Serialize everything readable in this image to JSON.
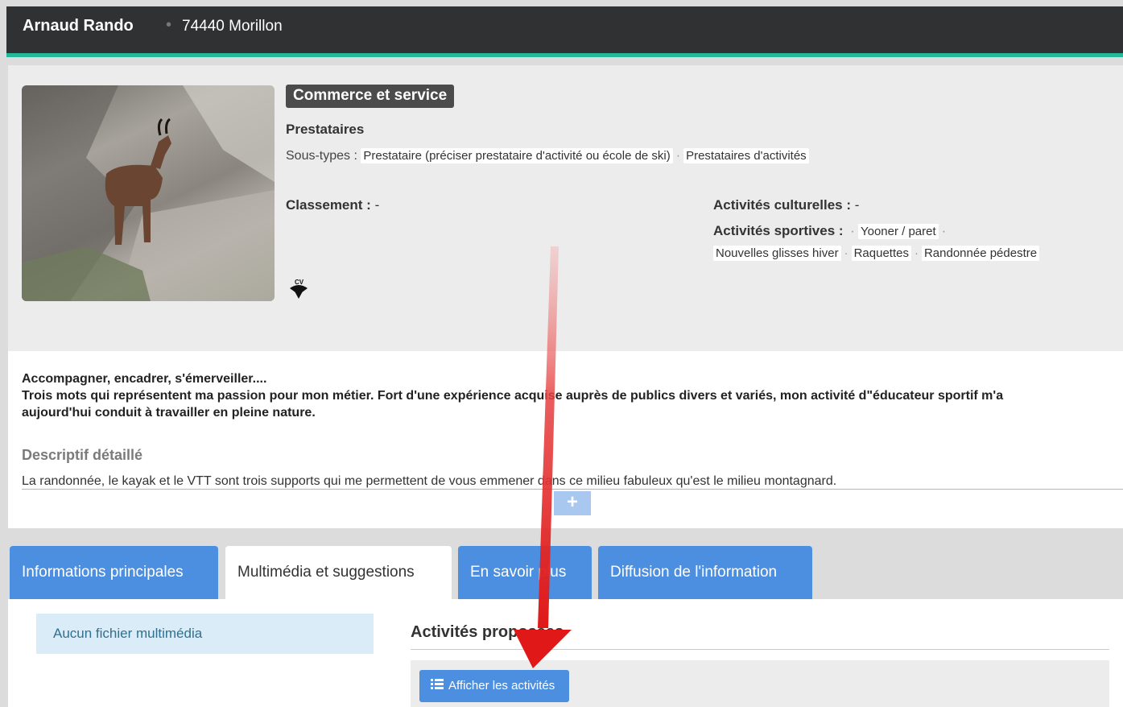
{
  "header": {
    "name": "Arnaud Rando",
    "separator": "•",
    "location": "74440 Morillon"
  },
  "summary": {
    "type_badge": "Commerce et service",
    "category": "Prestataires",
    "subtypes_label": "Sous-types :",
    "subtypes": [
      "Prestataire (préciser prestataire d'activité ou école de ski)",
      "Prestataires d'activités"
    ],
    "classement_label": "Classement :",
    "classement_value": "-",
    "activites_culturelles_label": "Activités culturelles :",
    "activites_culturelles_value": "-",
    "activites_sportives_label": "Activités sportives :",
    "activites_sportives": [
      "Yooner / paret",
      "Nouvelles glisses hiver",
      "Raquettes",
      "Randonnée pédestre"
    ],
    "photo_icon": "chamois-photo",
    "label_icon": "cv-label-icon"
  },
  "description": {
    "short_line1": "Accompagner, encadrer, s'émerveiller....",
    "short_line2": "Trois mots qui représentent ma passion pour mon métier. Fort d'une expérience acquise auprès de publics divers et variés, mon activité d\"éducateur sportif m'a aujourd'hui conduit à travailler en pleine nature.",
    "detail_title": "Descriptif détaillé",
    "detail_text": "La randonnée, le kayak et le VTT sont trois supports qui me permettent de vous emmener dans ce milieu fabuleux qu'est le milieu montagnard.",
    "more_button": "+"
  },
  "tabs": [
    {
      "label": "Informations principales"
    },
    {
      "label": "Multimédia et suggestions"
    },
    {
      "label": "En savoir plus"
    },
    {
      "label": "Diffusion de l'information"
    }
  ],
  "multimedia": {
    "empty_message": "Aucun fichier multimédia",
    "activities_title": "Activités proposées",
    "show_button": "Afficher les activités"
  },
  "colors": {
    "accent_tab": "#4c8fe0",
    "topbar": "#2f3133",
    "topbar_border": "#23b89a",
    "annotation_arrow": "#e02020"
  }
}
